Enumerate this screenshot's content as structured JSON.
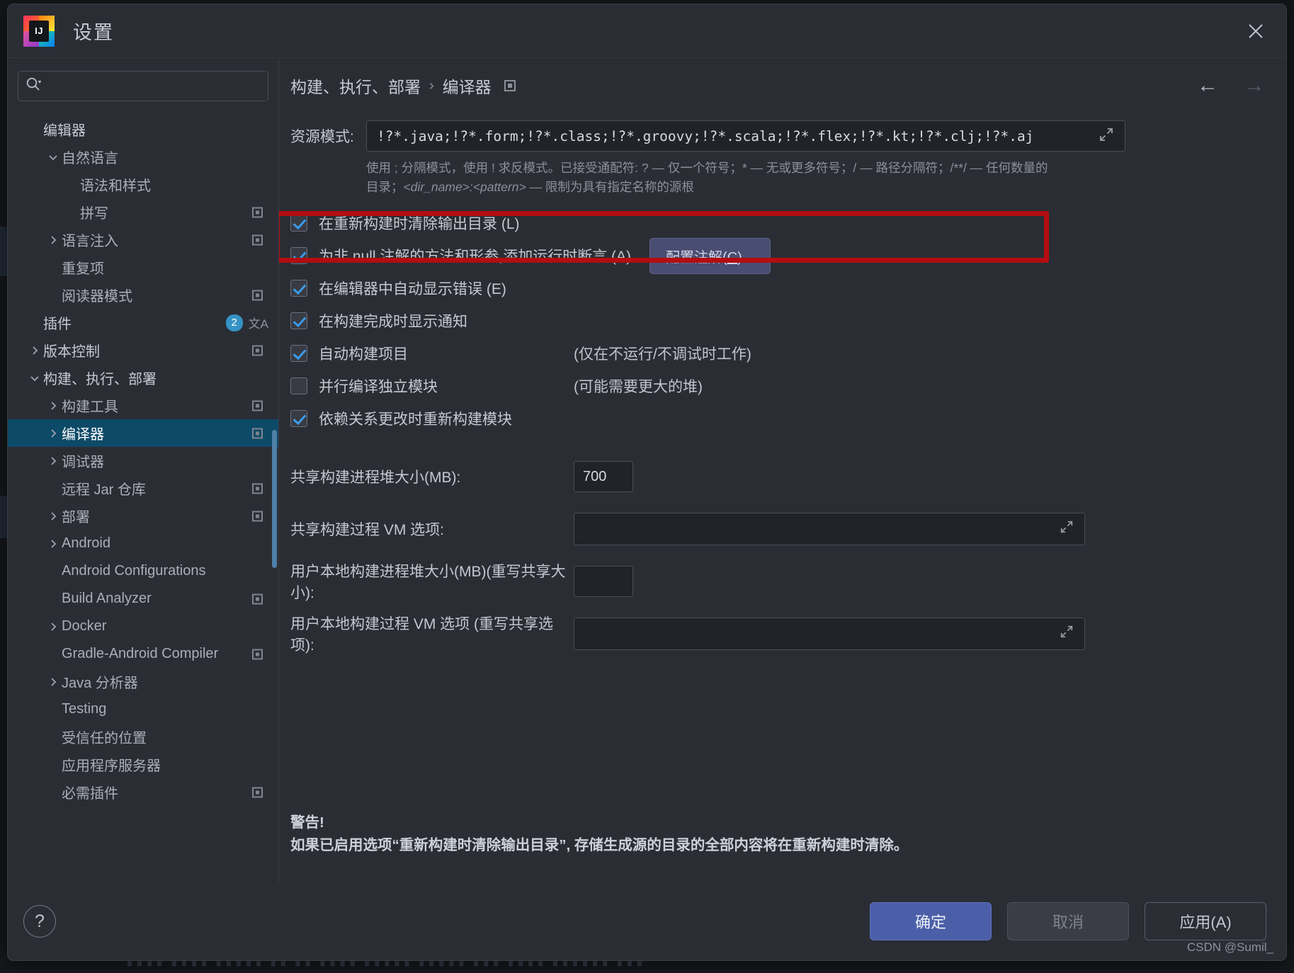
{
  "window": {
    "title": "设置",
    "logo_text": "IJ",
    "close_icon": "close-icon"
  },
  "sidebar": {
    "search": {
      "placeholder": "",
      "value": "",
      "icon": "search-icon"
    },
    "items": [
      {
        "label": "编辑器",
        "indent": 0,
        "arrow": "",
        "top": true,
        "selected": false,
        "cfg": false
      },
      {
        "label": "自然语言",
        "indent": 1,
        "arrow": "v",
        "top": false,
        "selected": false,
        "cfg": false
      },
      {
        "label": "语法和样式",
        "indent": 2,
        "arrow": "",
        "top": false,
        "selected": false,
        "cfg": false
      },
      {
        "label": "拼写",
        "indent": 2,
        "arrow": "",
        "top": false,
        "selected": false,
        "cfg": true
      },
      {
        "label": "语言注入",
        "indent": 1,
        "arrow": ">",
        "top": false,
        "selected": false,
        "cfg": true
      },
      {
        "label": "重复项",
        "indent": 1,
        "arrow": "",
        "top": false,
        "selected": false,
        "cfg": false
      },
      {
        "label": "阅读器模式",
        "indent": 1,
        "arrow": "",
        "top": false,
        "selected": false,
        "cfg": true
      },
      {
        "label": "插件",
        "indent": 0,
        "arrow": "",
        "top": true,
        "selected": false,
        "cfg": false,
        "badge": "2",
        "lang_icon": "translate-icon"
      },
      {
        "label": "版本控制",
        "indent": 0,
        "arrow": ">",
        "top": true,
        "selected": false,
        "cfg": true
      },
      {
        "label": "构建、执行、部署",
        "indent": 0,
        "arrow": "v",
        "top": true,
        "selected": false,
        "cfg": false
      },
      {
        "label": "构建工具",
        "indent": 1,
        "arrow": ">",
        "top": false,
        "selected": false,
        "cfg": true
      },
      {
        "label": "编译器",
        "indent": 1,
        "arrow": ">",
        "top": false,
        "selected": true,
        "cfg": true
      },
      {
        "label": "调试器",
        "indent": 1,
        "arrow": ">",
        "top": false,
        "selected": false,
        "cfg": false
      },
      {
        "label": "远程 Jar 仓库",
        "indent": 1,
        "arrow": "",
        "top": false,
        "selected": false,
        "cfg": true
      },
      {
        "label": "部署",
        "indent": 1,
        "arrow": ">",
        "top": false,
        "selected": false,
        "cfg": true
      },
      {
        "label": "Android",
        "indent": 1,
        "arrow": ">",
        "top": false,
        "selected": false,
        "cfg": false
      },
      {
        "label": "Android Configurations",
        "indent": 1,
        "arrow": "",
        "top": false,
        "selected": false,
        "cfg": false
      },
      {
        "label": "Build Analyzer",
        "indent": 1,
        "arrow": "",
        "top": false,
        "selected": false,
        "cfg": true
      },
      {
        "label": "Docker",
        "indent": 1,
        "arrow": ">",
        "top": false,
        "selected": false,
        "cfg": false
      },
      {
        "label": "Gradle-Android Compiler",
        "indent": 1,
        "arrow": "",
        "top": false,
        "selected": false,
        "cfg": true
      },
      {
        "label": "Java 分析器",
        "indent": 1,
        "arrow": ">",
        "top": false,
        "selected": false,
        "cfg": false
      },
      {
        "label": "Testing",
        "indent": 1,
        "arrow": "",
        "top": false,
        "selected": false,
        "cfg": false
      },
      {
        "label": "受信任的位置",
        "indent": 1,
        "arrow": "",
        "top": false,
        "selected": false,
        "cfg": false
      },
      {
        "label": "应用程序服务器",
        "indent": 1,
        "arrow": "",
        "top": false,
        "selected": false,
        "cfg": false
      },
      {
        "label": "必需插件",
        "indent": 1,
        "arrow": "",
        "top": false,
        "selected": false,
        "cfg": true
      }
    ]
  },
  "breadcrumb": {
    "parent": "构建、执行、部署",
    "separator": "›",
    "current": "编译器",
    "icon": "config-square-icon",
    "back_arrow": "←",
    "forward_arrow": "→"
  },
  "main": {
    "resource_pattern": {
      "label": "资源模式:",
      "value": "!?*.java;!?*.form;!?*.class;!?*.groovy;!?*.scala;!?*.flex;!?*.kt;!?*.clj;!?*.aj",
      "expand_icon": "expand-icon"
    },
    "helper_line1": "使用 ; 分隔模式，使用 ! 求反模式。已接受通配符: ? — 仅一个符号；* — 无或更多符号；/ — 路径分隔符；/**/ — 任何数量的",
    "helper_line2_prefix": "目录；",
    "helper_line2_italic": "<dir_name>:<pattern>",
    "helper_line2_suffix": " — 限制为具有指定名称的源根",
    "checkboxes": [
      {
        "label": "在重新构建时清除输出目录 (L)",
        "checked": true,
        "hint": "",
        "button": ""
      },
      {
        "label": "为非 null 注解的方法和形参,添加运行时断言 (A)",
        "checked": true,
        "hint": "",
        "button": "配置注解(C)..."
      },
      {
        "label": "在编辑器中自动显示错误 (E)",
        "checked": true,
        "hint": "",
        "button": ""
      },
      {
        "label": "在构建完成时显示通知",
        "checked": true,
        "hint": "",
        "button": ""
      },
      {
        "label": "自动构建项目",
        "checked": true,
        "hint": "(仅在不运行/不调试时工作)",
        "button": ""
      },
      {
        "label": "并行编译独立模块",
        "checked": false,
        "hint": "(可能需要更大的堆)",
        "button": ""
      },
      {
        "label": "依赖关系更改时重新构建模块",
        "checked": true,
        "hint": "",
        "button": ""
      }
    ],
    "annotate_button_label": "配置注解(C)...",
    "fields": [
      {
        "label": "共享构建进程堆大小(MB):",
        "value": "700",
        "wide": false,
        "expand": false
      },
      {
        "label": "共享构建过程 VM 选项:",
        "value": "",
        "wide": true,
        "expand": true
      },
      {
        "label": "用户本地构建进程堆大小(MB)(重写共享大小):",
        "value": "",
        "wide": false,
        "expand": false
      },
      {
        "label": "用户本地构建过程 VM 选项 (重写共享选项):",
        "value": "",
        "wide": true,
        "expand": true
      }
    ],
    "warning_title": "警告!",
    "warning_text": "如果已启用选项“重新构建时清除输出目录”, 存储生成源的目录的全部内容将在重新构建时清除。"
  },
  "footer": {
    "help_label": "?",
    "ok": "确定",
    "cancel": "取消",
    "apply": "应用(A)"
  },
  "watermark": "CSDN @Sumil_",
  "colors": {
    "selection": "#0d4a68",
    "accent": "#3592c4",
    "annotation": "#b40d10",
    "primary_button": "#4b5fa8"
  }
}
